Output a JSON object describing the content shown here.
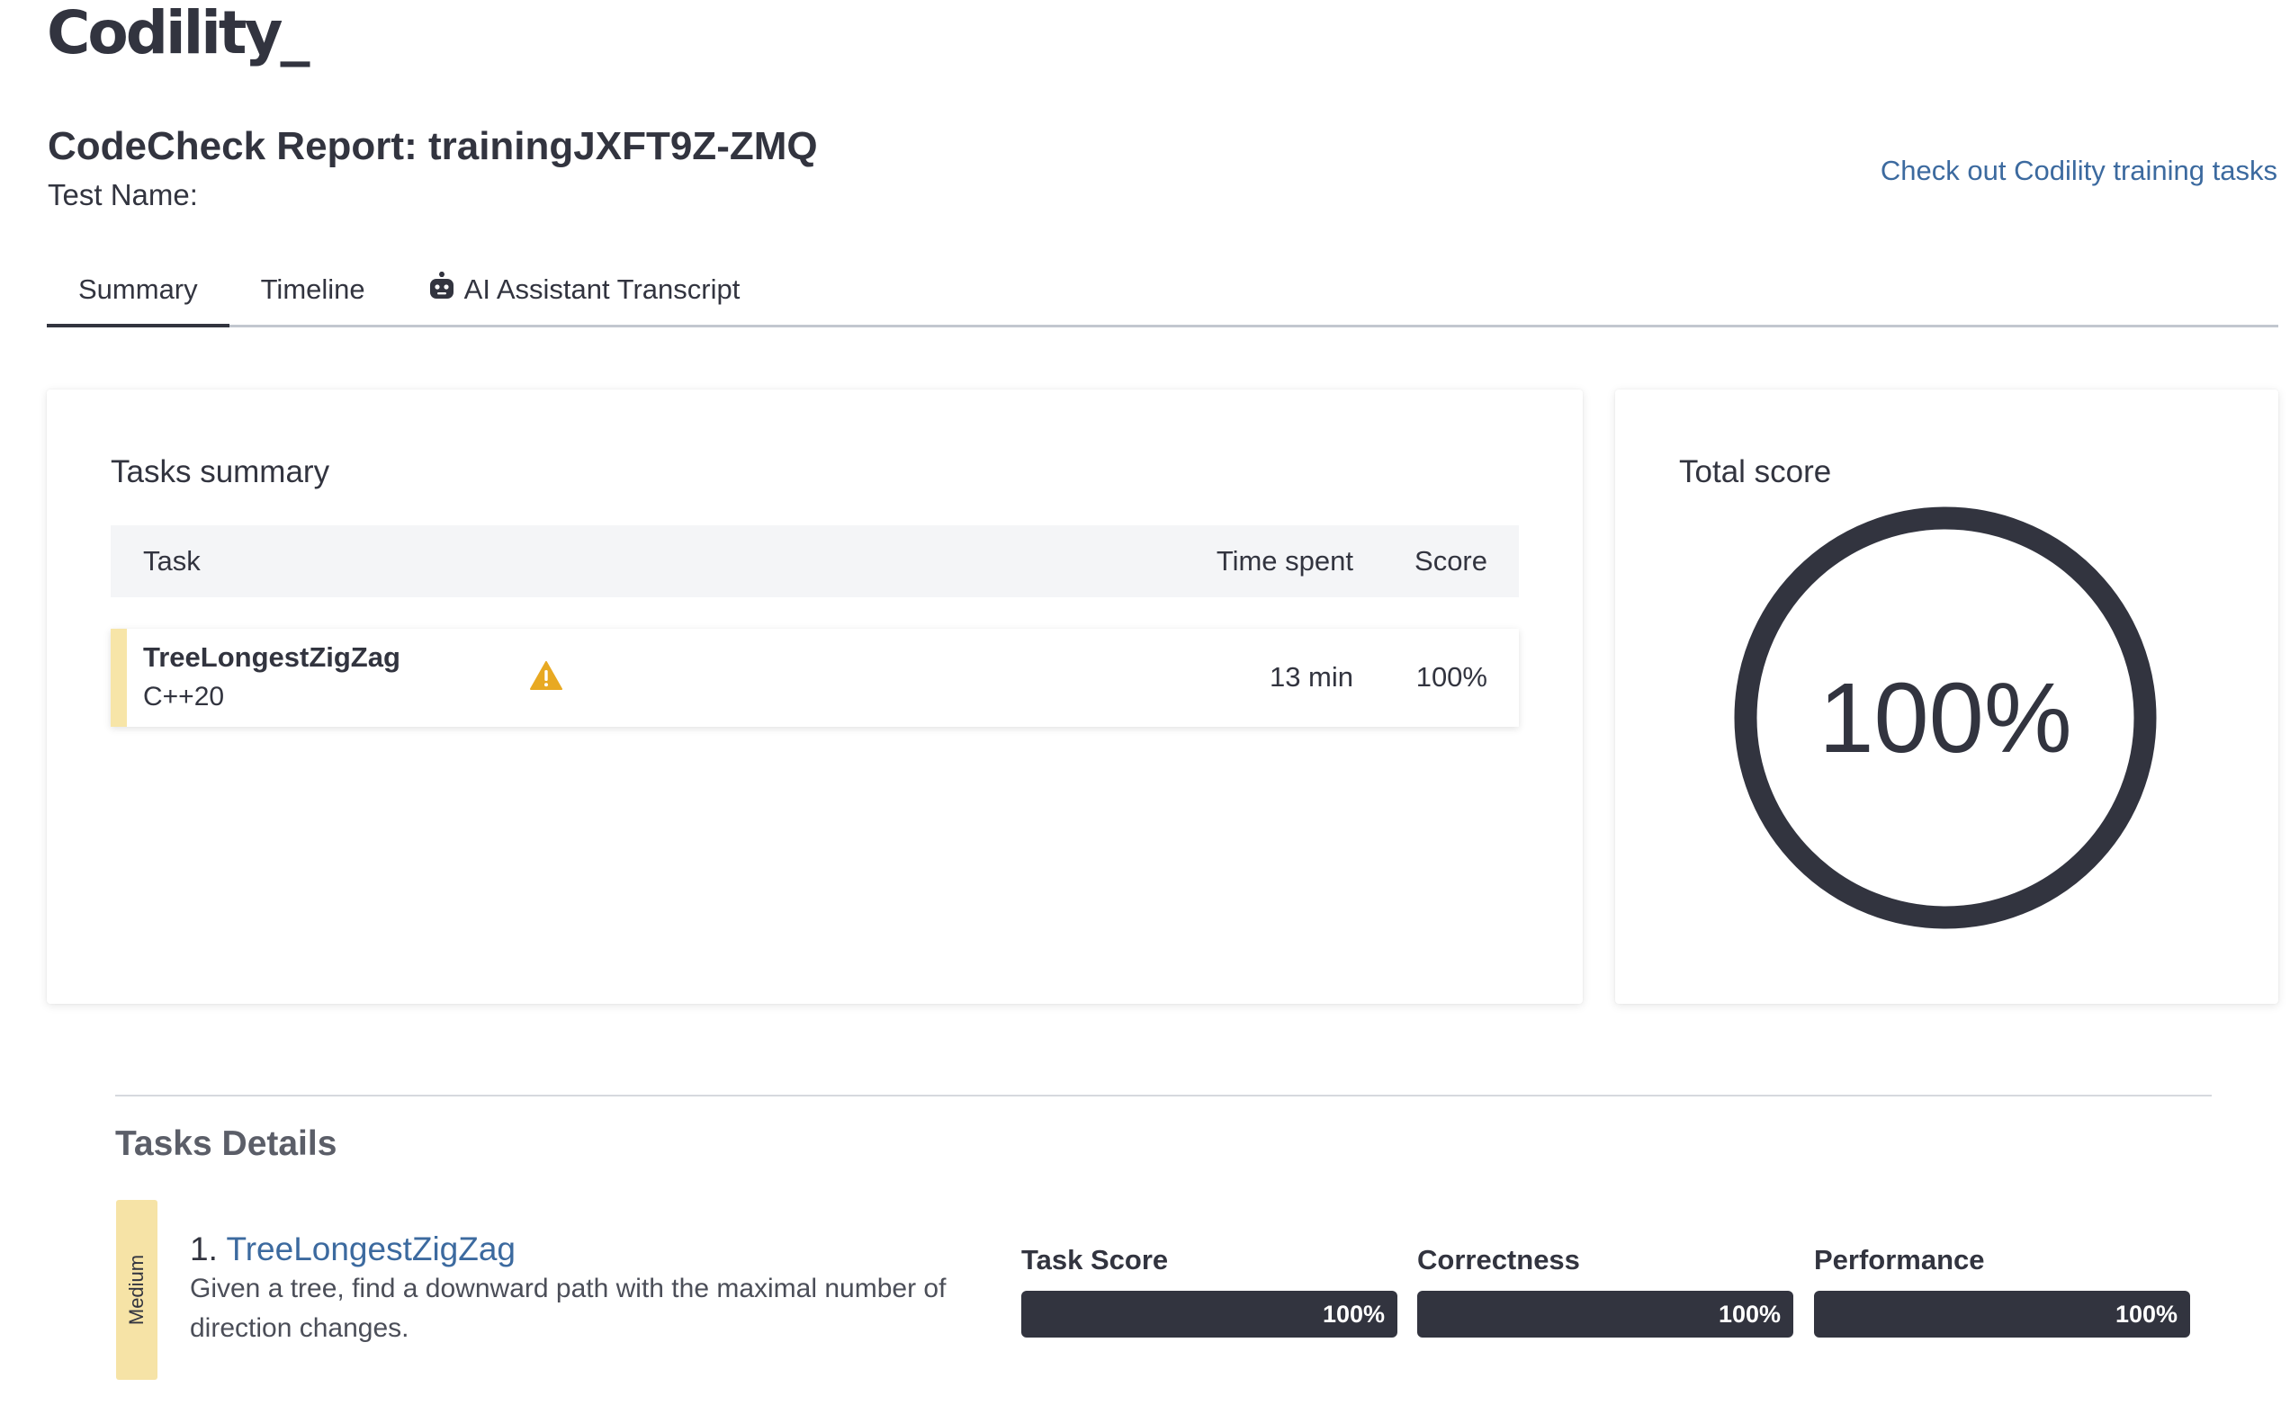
{
  "logo": {
    "text": "Codility",
    "cursor": "_"
  },
  "header": {
    "title": "CodeCheck Report: trainingJXFT9Z-ZMQ",
    "test_name_label": "Test Name:",
    "training_link": "Check out Codility training tasks"
  },
  "tabs": [
    {
      "label": "Summary",
      "active": true
    },
    {
      "label": "Timeline",
      "active": false
    },
    {
      "label": "AI Assistant Transcript",
      "active": false,
      "icon": "robot-icon"
    }
  ],
  "tasks_summary": {
    "title": "Tasks summary",
    "columns": {
      "task": "Task",
      "time_spent": "Time spent",
      "score": "Score"
    },
    "rows": [
      {
        "name": "TreeLongestZigZag",
        "language": "C++20",
        "warning_icon": "warning-icon",
        "time_spent": "13 min",
        "score": "100%"
      }
    ]
  },
  "total_score": {
    "title": "Total score",
    "value": "100%",
    "fraction": 1.0
  },
  "task_details": {
    "title": "Tasks Details",
    "items": [
      {
        "difficulty": "Medium",
        "number": "1.",
        "name": "TreeLongestZigZag",
        "description": "Given a tree, find a downward path with the maximal number of direction changes.",
        "metrics": [
          {
            "label": "Task Score",
            "value": "100%",
            "fraction": 1.0
          },
          {
            "label": "Correctness",
            "value": "100%",
            "fraction": 1.0
          },
          {
            "label": "Performance",
            "value": "100%",
            "fraction": 1.0
          }
        ]
      }
    ]
  },
  "colors": {
    "text": "#32343f",
    "link": "#3c6a9f",
    "accent_yellow": "#f7e5a8",
    "warning": "#e8a922"
  }
}
